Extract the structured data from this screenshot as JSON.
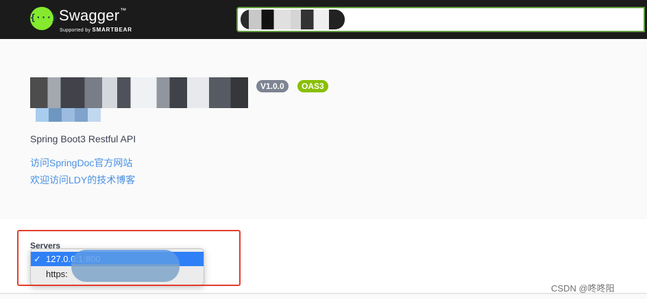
{
  "header": {
    "logo_glyph": "{···}",
    "app_name": "Swagger",
    "app_tm": "™",
    "supported_prefix": "Supported by",
    "supported_brand": "SMARTBEAR",
    "url_value": ""
  },
  "info": {
    "version_badge": "V1.0.0",
    "oas_badge": "OAS3",
    "description": "Spring Boot3 Restful API",
    "links": [
      {
        "label": "访问SpringDoc官方网站"
      },
      {
        "label": "欢迎访问LDY的技术博客"
      }
    ]
  },
  "servers": {
    "label": "Servers",
    "options": [
      {
        "check": "✓",
        "label": "127.0.0.1:800",
        "selected": true
      },
      {
        "check": "",
        "label": "https:",
        "selected": false
      }
    ]
  },
  "watermark": "CSDN @咚咚阳",
  "colors": {
    "topbar": "#1b1b1b",
    "accent_green": "#85ea2d",
    "oas_green": "#89bf04",
    "version_gray": "#7d8492",
    "link_blue": "#4990e2",
    "select_blue": "#2f80f6",
    "highlight_red": "#e53a2a"
  }
}
